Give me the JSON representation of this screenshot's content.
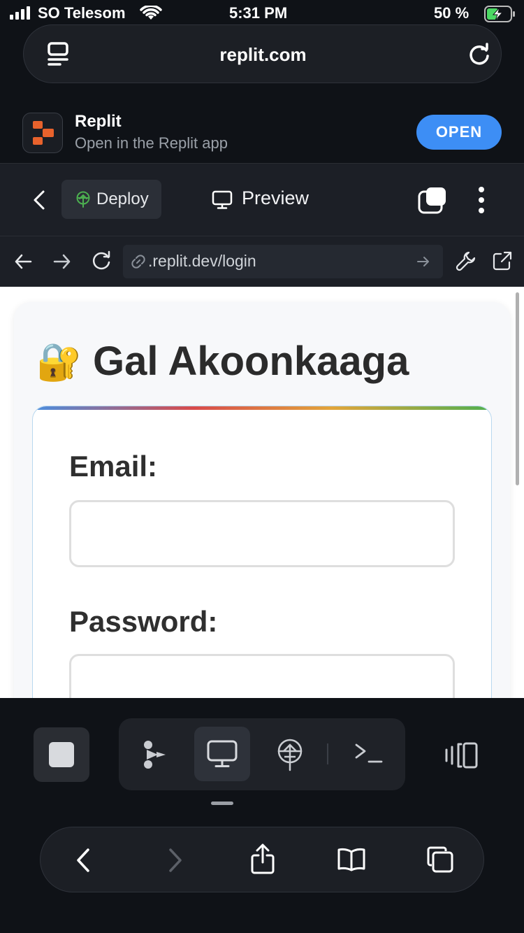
{
  "status_bar": {
    "carrier": "SO Telesom",
    "time": "5:31 PM",
    "battery_percent": "50 %",
    "battery_level": 0.5
  },
  "safari": {
    "url": "replit.com"
  },
  "app_banner": {
    "app_name": "Replit",
    "subtitle": "Open in the Replit app",
    "open_label": "OPEN"
  },
  "replit_toolbar": {
    "deploy_label": "Deploy",
    "preview_label": "Preview"
  },
  "preview_browser": {
    "url": ".replit.dev/login"
  },
  "page": {
    "title_emoji": "🔐",
    "title": "Gal Akoonkaaga",
    "email_label": "Email:",
    "email_value": "",
    "password_label": "Password:",
    "password_value": ""
  },
  "colors": {
    "open_button": "#3d8ef5",
    "deploy_icon": "#4caf50",
    "battery_charging": "#4cd964"
  }
}
